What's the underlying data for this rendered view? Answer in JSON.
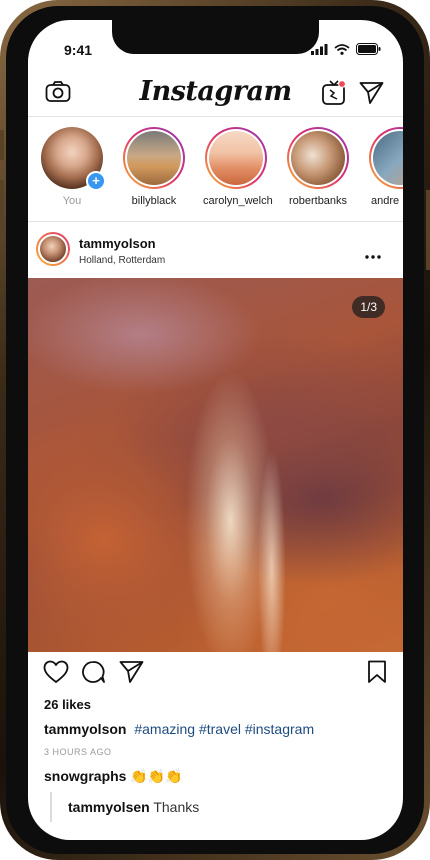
{
  "status": {
    "time": "9:41"
  },
  "header": {
    "logo": "Instagram",
    "camera_icon": "camera-icon",
    "igtv_icon": "igtv-icon",
    "direct_icon": "direct-message-icon"
  },
  "stories": [
    {
      "label": "You"
    },
    {
      "label": "billyblack"
    },
    {
      "label": "carolyn_welch"
    },
    {
      "label": "robertbanks"
    },
    {
      "label": "andre"
    }
  ],
  "post": {
    "username": "tammyolson",
    "location": "Holland, Rotterdam",
    "page_indicator": "1/3",
    "likes": "26 likes",
    "caption_user": "tammyolson",
    "caption_tags": "#amazing #travel #instagram",
    "timestamp": "3 HOURS AGO",
    "comment": {
      "user": "snowgraphs",
      "text": "👏👏👏"
    },
    "reply": {
      "user": "tammyolsen",
      "text": "Thanks"
    }
  },
  "colors": {
    "accent": "#3897f0",
    "hashtag": "#1e4b80",
    "story_ring_start": "#f7b733",
    "story_ring_end": "#8a3ab9"
  }
}
